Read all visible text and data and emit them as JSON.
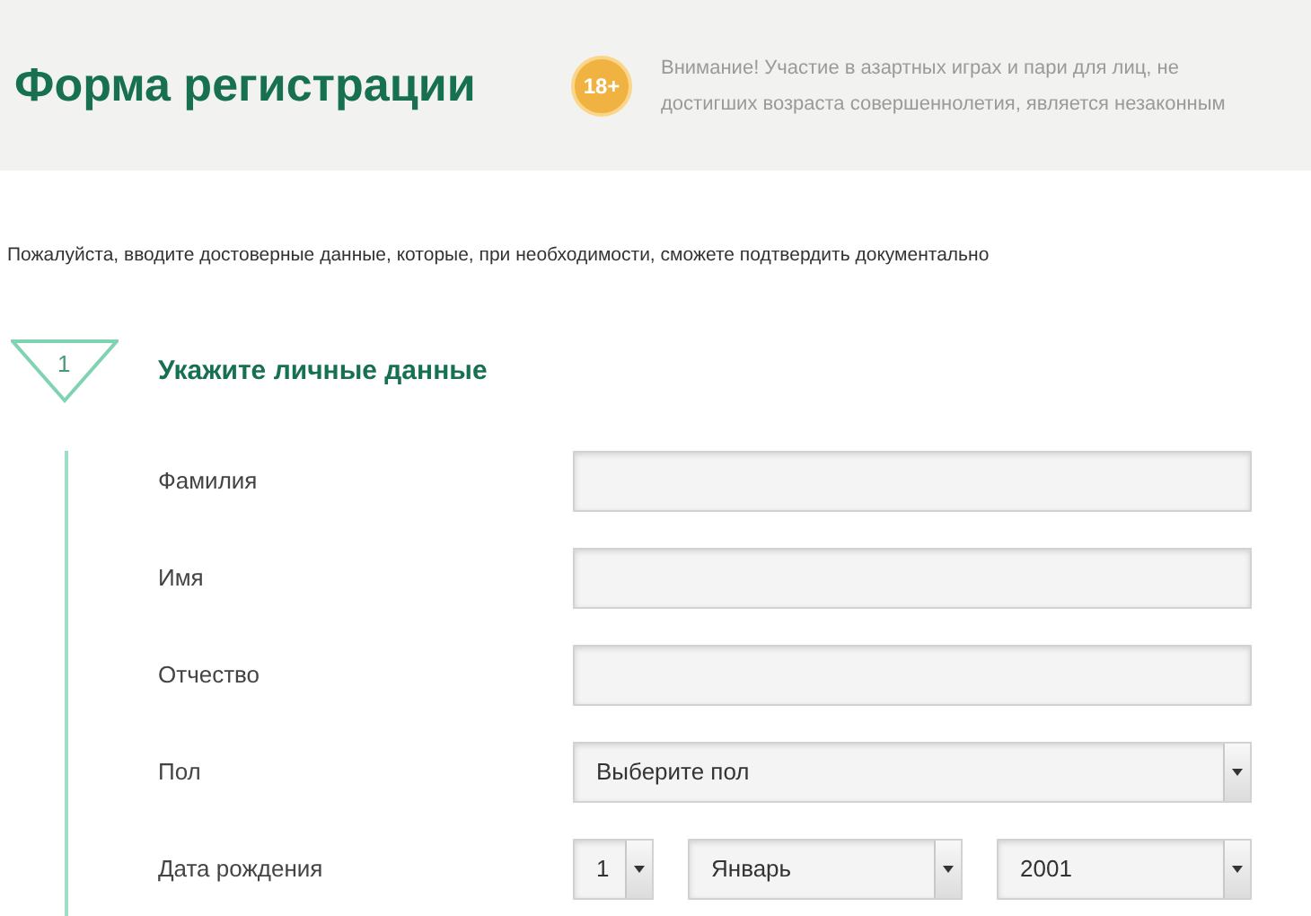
{
  "header": {
    "title": "Форма регистрации",
    "age_badge": "18+",
    "warning": "Внимание! Участие в азартных играх и пари для лиц, не достигших возраста совершеннолетия, является незаконным"
  },
  "intro": "Пожалуйста, вводите достоверные данные, которые, при необходимости, сможете подтвердить документально",
  "step": {
    "number": "1",
    "title": "Укажите личные данные"
  },
  "fields": [
    {
      "kind": "text",
      "label": "Фамилия"
    },
    {
      "kind": "text",
      "label": "Имя"
    },
    {
      "kind": "text",
      "label": "Отчество"
    },
    {
      "kind": "select",
      "label": "Пол",
      "value": "Выберите пол"
    },
    {
      "kind": "date",
      "label": "Дата рождения",
      "day": "1",
      "month": "Январь",
      "year": "2001"
    }
  ]
}
